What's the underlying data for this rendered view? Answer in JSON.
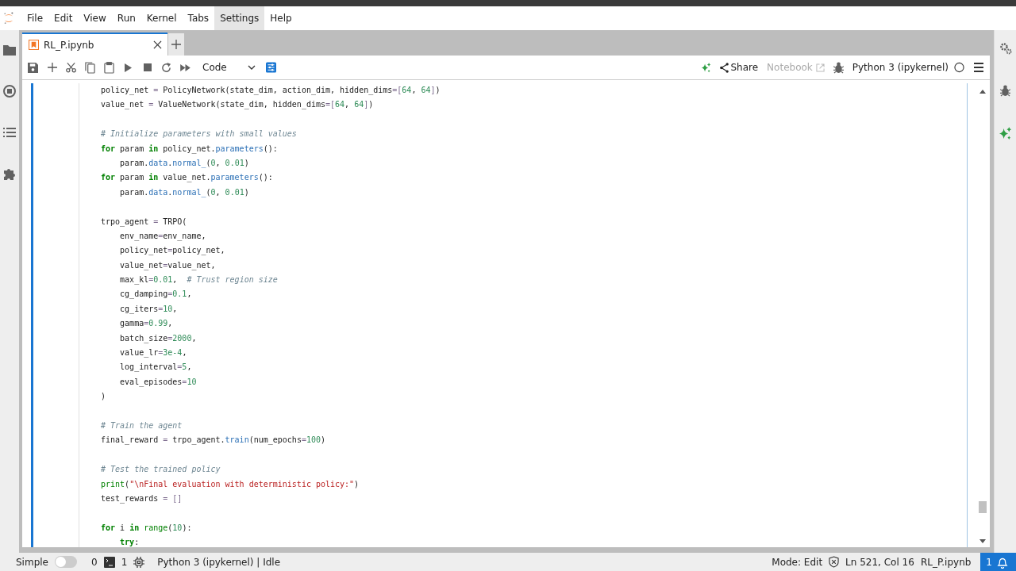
{
  "menu": [
    {
      "label": "File",
      "highlighted": false
    },
    {
      "label": "Edit",
      "highlighted": false
    },
    {
      "label": "View",
      "highlighted": false
    },
    {
      "label": "Run",
      "highlighted": false
    },
    {
      "label": "Kernel",
      "highlighted": false
    },
    {
      "label": "Tabs",
      "highlighted": false
    },
    {
      "label": "Settings",
      "highlighted": true
    },
    {
      "label": "Help",
      "highlighted": false
    }
  ],
  "tabs": [
    {
      "title": "RL_P.ipynb",
      "selected": true
    }
  ],
  "toolbar": {
    "cell_type": "Code",
    "share": "Share",
    "notebook": "Notebook",
    "kernel": "Python 3 (ipykernel)"
  },
  "lines": [
    {
      "kind": "code",
      "tokens": [
        {
          "kind": "t",
          "text": "policy_net "
        },
        {
          "kind": "o",
          "text": "="
        },
        {
          "kind": "t",
          "text": " PolicyNetwork(state_dim, action_dim, hidden_dims"
        },
        {
          "kind": "o",
          "text": "=["
        },
        {
          "kind": "n",
          "text": "64"
        },
        {
          "kind": "t",
          "text": ", "
        },
        {
          "kind": "n",
          "text": "64"
        },
        {
          "kind": "o",
          "text": "]"
        },
        {
          "kind": "t",
          "text": ")"
        }
      ]
    },
    {
      "kind": "code",
      "tokens": [
        {
          "kind": "t",
          "text": "value_net "
        },
        {
          "kind": "o",
          "text": "="
        },
        {
          "kind": "t",
          "text": " ValueNetwork(state_dim, hidden_dims"
        },
        {
          "kind": "o",
          "text": "=["
        },
        {
          "kind": "n",
          "text": "64"
        },
        {
          "kind": "t",
          "text": ", "
        },
        {
          "kind": "n",
          "text": "64"
        },
        {
          "kind": "o",
          "text": "]"
        },
        {
          "kind": "t",
          "text": ")"
        }
      ]
    },
    {
      "kind": "blank"
    },
    {
      "kind": "code",
      "tokens": [
        {
          "kind": "c",
          "text": "# Initialize parameters with small values"
        }
      ]
    },
    {
      "kind": "code",
      "tokens": [
        {
          "kind": "k",
          "text": "for"
        },
        {
          "kind": "t",
          "text": " param "
        },
        {
          "kind": "k",
          "text": "in"
        },
        {
          "kind": "t",
          "text": " policy_net."
        },
        {
          "kind": "a",
          "text": "parameters"
        },
        {
          "kind": "t",
          "text": "():"
        }
      ]
    },
    {
      "kind": "code",
      "tokens": [
        {
          "kind": "t",
          "text": "    param."
        },
        {
          "kind": "a",
          "text": "data"
        },
        {
          "kind": "t",
          "text": "."
        },
        {
          "kind": "a",
          "text": "normal_"
        },
        {
          "kind": "t",
          "text": "("
        },
        {
          "kind": "n",
          "text": "0"
        },
        {
          "kind": "t",
          "text": ", "
        },
        {
          "kind": "n",
          "text": "0.01"
        },
        {
          "kind": "t",
          "text": ")"
        }
      ]
    },
    {
      "kind": "code",
      "tokens": [
        {
          "kind": "k",
          "text": "for"
        },
        {
          "kind": "t",
          "text": " param "
        },
        {
          "kind": "k",
          "text": "in"
        },
        {
          "kind": "t",
          "text": " value_net."
        },
        {
          "kind": "a",
          "text": "parameters"
        },
        {
          "kind": "t",
          "text": "():"
        }
      ]
    },
    {
      "kind": "code",
      "tokens": [
        {
          "kind": "t",
          "text": "    param."
        },
        {
          "kind": "a",
          "text": "data"
        },
        {
          "kind": "t",
          "text": "."
        },
        {
          "kind": "a",
          "text": "normal_"
        },
        {
          "kind": "t",
          "text": "("
        },
        {
          "kind": "n",
          "text": "0"
        },
        {
          "kind": "t",
          "text": ", "
        },
        {
          "kind": "n",
          "text": "0.01"
        },
        {
          "kind": "t",
          "text": ")"
        }
      ]
    },
    {
      "kind": "blank"
    },
    {
      "kind": "code",
      "tokens": [
        {
          "kind": "t",
          "text": "trpo_agent "
        },
        {
          "kind": "o",
          "text": "="
        },
        {
          "kind": "t",
          "text": " TRPO("
        }
      ]
    },
    {
      "kind": "code",
      "tokens": [
        {
          "kind": "t",
          "text": "    env_name"
        },
        {
          "kind": "o",
          "text": "="
        },
        {
          "kind": "t",
          "text": "env_name,"
        }
      ]
    },
    {
      "kind": "code",
      "tokens": [
        {
          "kind": "t",
          "text": "    policy_net"
        },
        {
          "kind": "o",
          "text": "="
        },
        {
          "kind": "t",
          "text": "policy_net,"
        }
      ]
    },
    {
      "kind": "code",
      "tokens": [
        {
          "kind": "t",
          "text": "    value_net"
        },
        {
          "kind": "o",
          "text": "="
        },
        {
          "kind": "t",
          "text": "value_net,"
        }
      ]
    },
    {
      "kind": "code",
      "tokens": [
        {
          "kind": "t",
          "text": "    max_kl"
        },
        {
          "kind": "o",
          "text": "="
        },
        {
          "kind": "n",
          "text": "0.01"
        },
        {
          "kind": "t",
          "text": ",  "
        },
        {
          "kind": "c",
          "text": "# Trust region size"
        }
      ]
    },
    {
      "kind": "code",
      "tokens": [
        {
          "kind": "t",
          "text": "    cg_damping"
        },
        {
          "kind": "o",
          "text": "="
        },
        {
          "kind": "n",
          "text": "0.1"
        },
        {
          "kind": "t",
          "text": ","
        }
      ]
    },
    {
      "kind": "code",
      "tokens": [
        {
          "kind": "t",
          "text": "    cg_iters"
        },
        {
          "kind": "o",
          "text": "="
        },
        {
          "kind": "n",
          "text": "10"
        },
        {
          "kind": "t",
          "text": ","
        }
      ]
    },
    {
      "kind": "code",
      "tokens": [
        {
          "kind": "t",
          "text": "    gamma"
        },
        {
          "kind": "o",
          "text": "="
        },
        {
          "kind": "n",
          "text": "0.99"
        },
        {
          "kind": "t",
          "text": ","
        }
      ]
    },
    {
      "kind": "code",
      "tokens": [
        {
          "kind": "t",
          "text": "    batch_size"
        },
        {
          "kind": "o",
          "text": "="
        },
        {
          "kind": "n",
          "text": "2000"
        },
        {
          "kind": "t",
          "text": ","
        }
      ]
    },
    {
      "kind": "code",
      "tokens": [
        {
          "kind": "t",
          "text": "    value_lr"
        },
        {
          "kind": "o",
          "text": "="
        },
        {
          "kind": "n",
          "text": "3e-4"
        },
        {
          "kind": "t",
          "text": ","
        }
      ]
    },
    {
      "kind": "code",
      "tokens": [
        {
          "kind": "t",
          "text": "    log_interval"
        },
        {
          "kind": "o",
          "text": "="
        },
        {
          "kind": "n",
          "text": "5"
        },
        {
          "kind": "t",
          "text": ","
        }
      ]
    },
    {
      "kind": "code",
      "tokens": [
        {
          "kind": "t",
          "text": "    eval_episodes"
        },
        {
          "kind": "o",
          "text": "="
        },
        {
          "kind": "n",
          "text": "10"
        }
      ]
    },
    {
      "kind": "code",
      "tokens": [
        {
          "kind": "t",
          "text": ")"
        }
      ]
    },
    {
      "kind": "blank"
    },
    {
      "kind": "code",
      "tokens": [
        {
          "kind": "c",
          "text": "# Train the agent"
        }
      ]
    },
    {
      "kind": "code",
      "tokens": [
        {
          "kind": "t",
          "text": "final_reward "
        },
        {
          "kind": "o",
          "text": "="
        },
        {
          "kind": "t",
          "text": " trpo_agent."
        },
        {
          "kind": "a",
          "text": "train"
        },
        {
          "kind": "t",
          "text": "(num_epochs"
        },
        {
          "kind": "o",
          "text": "="
        },
        {
          "kind": "n",
          "text": "100"
        },
        {
          "kind": "t",
          "text": ")"
        }
      ]
    },
    {
      "kind": "blank"
    },
    {
      "kind": "code",
      "tokens": [
        {
          "kind": "c",
          "text": "# Test the trained policy"
        }
      ]
    },
    {
      "kind": "code",
      "tokens": [
        {
          "kind": "b",
          "text": "print"
        },
        {
          "kind": "t",
          "text": "("
        },
        {
          "kind": "s",
          "text": "\"\\nFinal evaluation with deterministic policy:\""
        },
        {
          "kind": "t",
          "text": ")"
        }
      ]
    },
    {
      "kind": "code",
      "tokens": [
        {
          "kind": "t",
          "text": "test_rewards "
        },
        {
          "kind": "o",
          "text": "= []"
        }
      ]
    },
    {
      "kind": "blank"
    },
    {
      "kind": "code",
      "tokens": [
        {
          "kind": "k",
          "text": "for"
        },
        {
          "kind": "t",
          "text": " i "
        },
        {
          "kind": "k",
          "text": "in"
        },
        {
          "kind": "b",
          "text": " range"
        },
        {
          "kind": "t",
          "text": "("
        },
        {
          "kind": "n",
          "text": "10"
        },
        {
          "kind": "t",
          "text": "):"
        }
      ]
    },
    {
      "kind": "code",
      "tokens": [
        {
          "kind": "k",
          "text": "    try"
        },
        {
          "kind": "t",
          "text": ":"
        }
      ]
    }
  ],
  "status_bar": {
    "simple_label": "Simple",
    "simple_on": false,
    "terminals": "0",
    "kernels": "1",
    "kernel_status": "Python 3 (ipykernel) | Idle",
    "mode": "Mode: Edit",
    "position": "Ln 521, Col 16",
    "file": "RL_P.ipynb",
    "notifications": "1"
  }
}
